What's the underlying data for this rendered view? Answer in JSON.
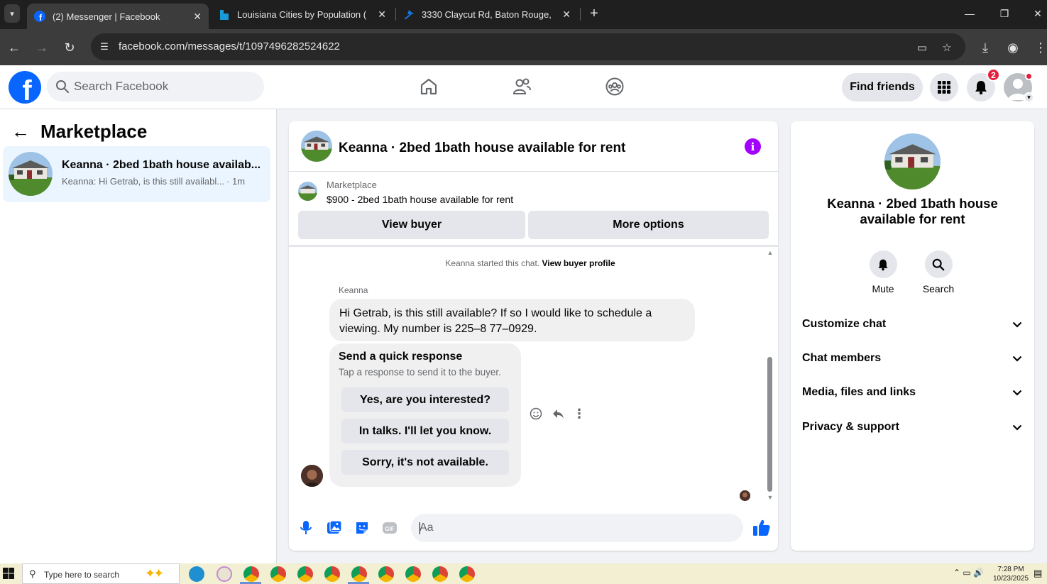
{
  "browser": {
    "tabs": [
      {
        "title": "(2) Messenger | Facebook",
        "active": true,
        "icon": "facebook-icon"
      },
      {
        "title": "Louisiana Cities by Population (",
        "active": false,
        "icon": "bookmark-flag-icon"
      },
      {
        "title": "3330 Claycut Rd, Baton Rouge,",
        "active": false,
        "icon": "zillow-icon"
      }
    ],
    "url": "facebook.com/messages/t/1097496282524622"
  },
  "fb_header": {
    "search_placeholder": "Search Facebook",
    "find_friends_label": "Find friends",
    "notification_count": "2"
  },
  "sidebar": {
    "title": "Marketplace",
    "conversations": [
      {
        "title": "Keanna · 2bed 1bath house availab...",
        "preview": "Keanna: Hi Getrab, is this still availabl...",
        "time": "· 1m"
      }
    ]
  },
  "chat": {
    "title": "Keanna · 2bed 1bath house available for rent",
    "listing": {
      "source": "Marketplace",
      "name": "$900 - 2bed 1bath house available for rent",
      "view_buyer_label": "View buyer",
      "more_options_label": "More options"
    },
    "started_text": "Keanna started this chat.",
    "view_profile_link": "View buyer profile",
    "sender_name": "Keanna",
    "message": "Hi Getrab, is this still available? If so I would like to schedule a viewing. My number is 225–8 77–0929.",
    "quick_response": {
      "title": "Send a quick response",
      "subtitle": "Tap a response to send it to the buyer.",
      "options": [
        "Yes, are you interested?",
        "In talks. I'll let you know.",
        "Sorry, it's not available."
      ]
    },
    "composer_placeholder": "Aa"
  },
  "info_panel": {
    "name": "Keanna · 2bed 1bath house available for rent",
    "actions": [
      {
        "label": "Mute",
        "icon": "bell-icon"
      },
      {
        "label": "Search",
        "icon": "search-icon"
      }
    ],
    "sections": [
      "Customize chat",
      "Chat members",
      "Media, files and links",
      "Privacy & support"
    ]
  },
  "taskbar": {
    "search_placeholder": "Type here to search",
    "time": "7:28 PM",
    "date": "10/23/2025"
  },
  "colors": {
    "facebook_blue": "#0866ff",
    "messenger_accent": "#a200ff",
    "selected_conversation": "#ebf5ff",
    "badge_red": "#e41e3f"
  }
}
